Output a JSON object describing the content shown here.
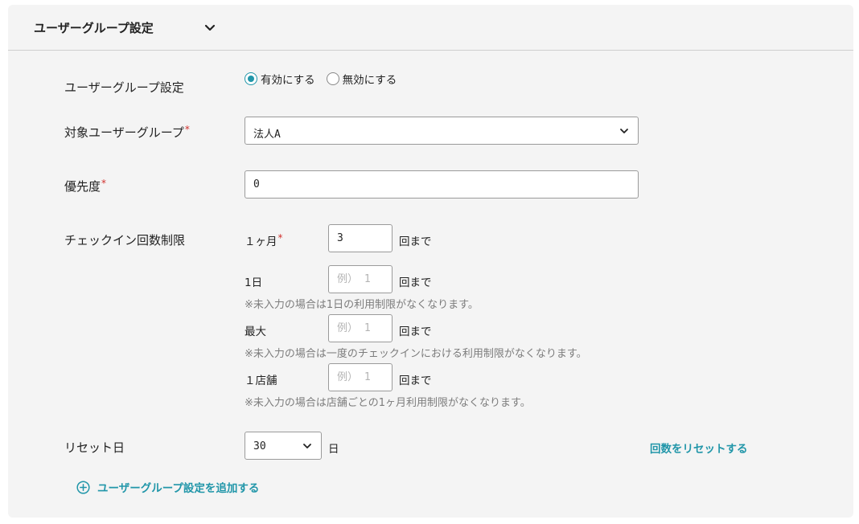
{
  "section": {
    "title": "ユーザーグループ設定",
    "toggle_icon": "chevron-down-icon"
  },
  "form": {
    "group_setting": {
      "label": "ユーザーグループ設定",
      "options": [
        "有効にする",
        "無効にする"
      ],
      "selected": "有効にする"
    },
    "target_group": {
      "label": "対象ユーザーグループ",
      "required_mark": "*",
      "value": "法人A"
    },
    "priority": {
      "label": "優先度",
      "required_mark": "*",
      "value": "0"
    },
    "checkin_limit": {
      "label": "チェックイン回数制限",
      "unit": "回まで",
      "monthly": {
        "label": "１ヶ月",
        "required_mark": "*",
        "value": "3"
      },
      "daily": {
        "label": "1日",
        "placeholder": "例） 1",
        "note": "※未入力の場合は1日の利用制限がなくなります。"
      },
      "max": {
        "label": "最大",
        "placeholder": "例） 1",
        "note": "※未入力の場合は一度のチェックインにおける利用制限がなくなります。"
      },
      "per_store": {
        "label": "１店舗",
        "placeholder": "例） 1",
        "note": "※未入力の場合は店舗ごとの1ヶ月利用制限がなくなります。"
      }
    },
    "reset_day": {
      "label": "リセット日",
      "value": "30",
      "unit": "日",
      "reset_link": "回数をリセットする"
    },
    "add_group_link": "ユーザーグループ設定を追加する"
  },
  "colors": {
    "accent": "#2196a9",
    "required": "#d0312d",
    "card_bg": "#f4f4f4"
  }
}
